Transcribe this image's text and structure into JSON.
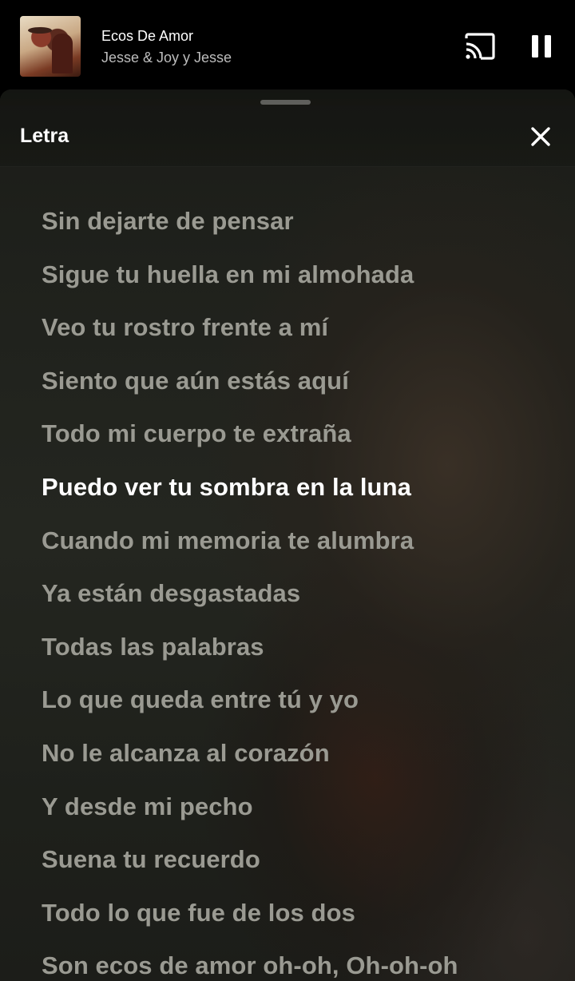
{
  "mini_player": {
    "title": "Ecos De Amor",
    "artist": "Jesse & Joy y Jesse",
    "icons": {
      "album_art": "album-art",
      "cast": "cast-icon",
      "pause": "pause-icon"
    }
  },
  "lyrics_sheet": {
    "title": "Letra",
    "close_icon": "close-icon",
    "active_index": 5,
    "lines": [
      "Sin dejarte de pensar",
      "Sigue tu huella en mi almohada",
      "Veo tu rostro frente a mí",
      "Siento que aún estás aquí",
      "Todo mi cuerpo te extraña",
      "Puedo ver tu sombra en la luna",
      "Cuando mi memoria te alumbra",
      "Ya están desgastadas",
      "Todas las palabras",
      "Lo que queda entre tú y yo",
      "No le alcanza al corazón",
      "Y desde mi pecho",
      "Suena tu recuerdo",
      "Todo lo que fue de los dos",
      "Son ecos de amor oh-oh, Oh-oh-oh"
    ]
  },
  "colors": {
    "active_lyric": "#ffffff",
    "inactive_lyric": "#9a9a92",
    "background": "#000000"
  }
}
